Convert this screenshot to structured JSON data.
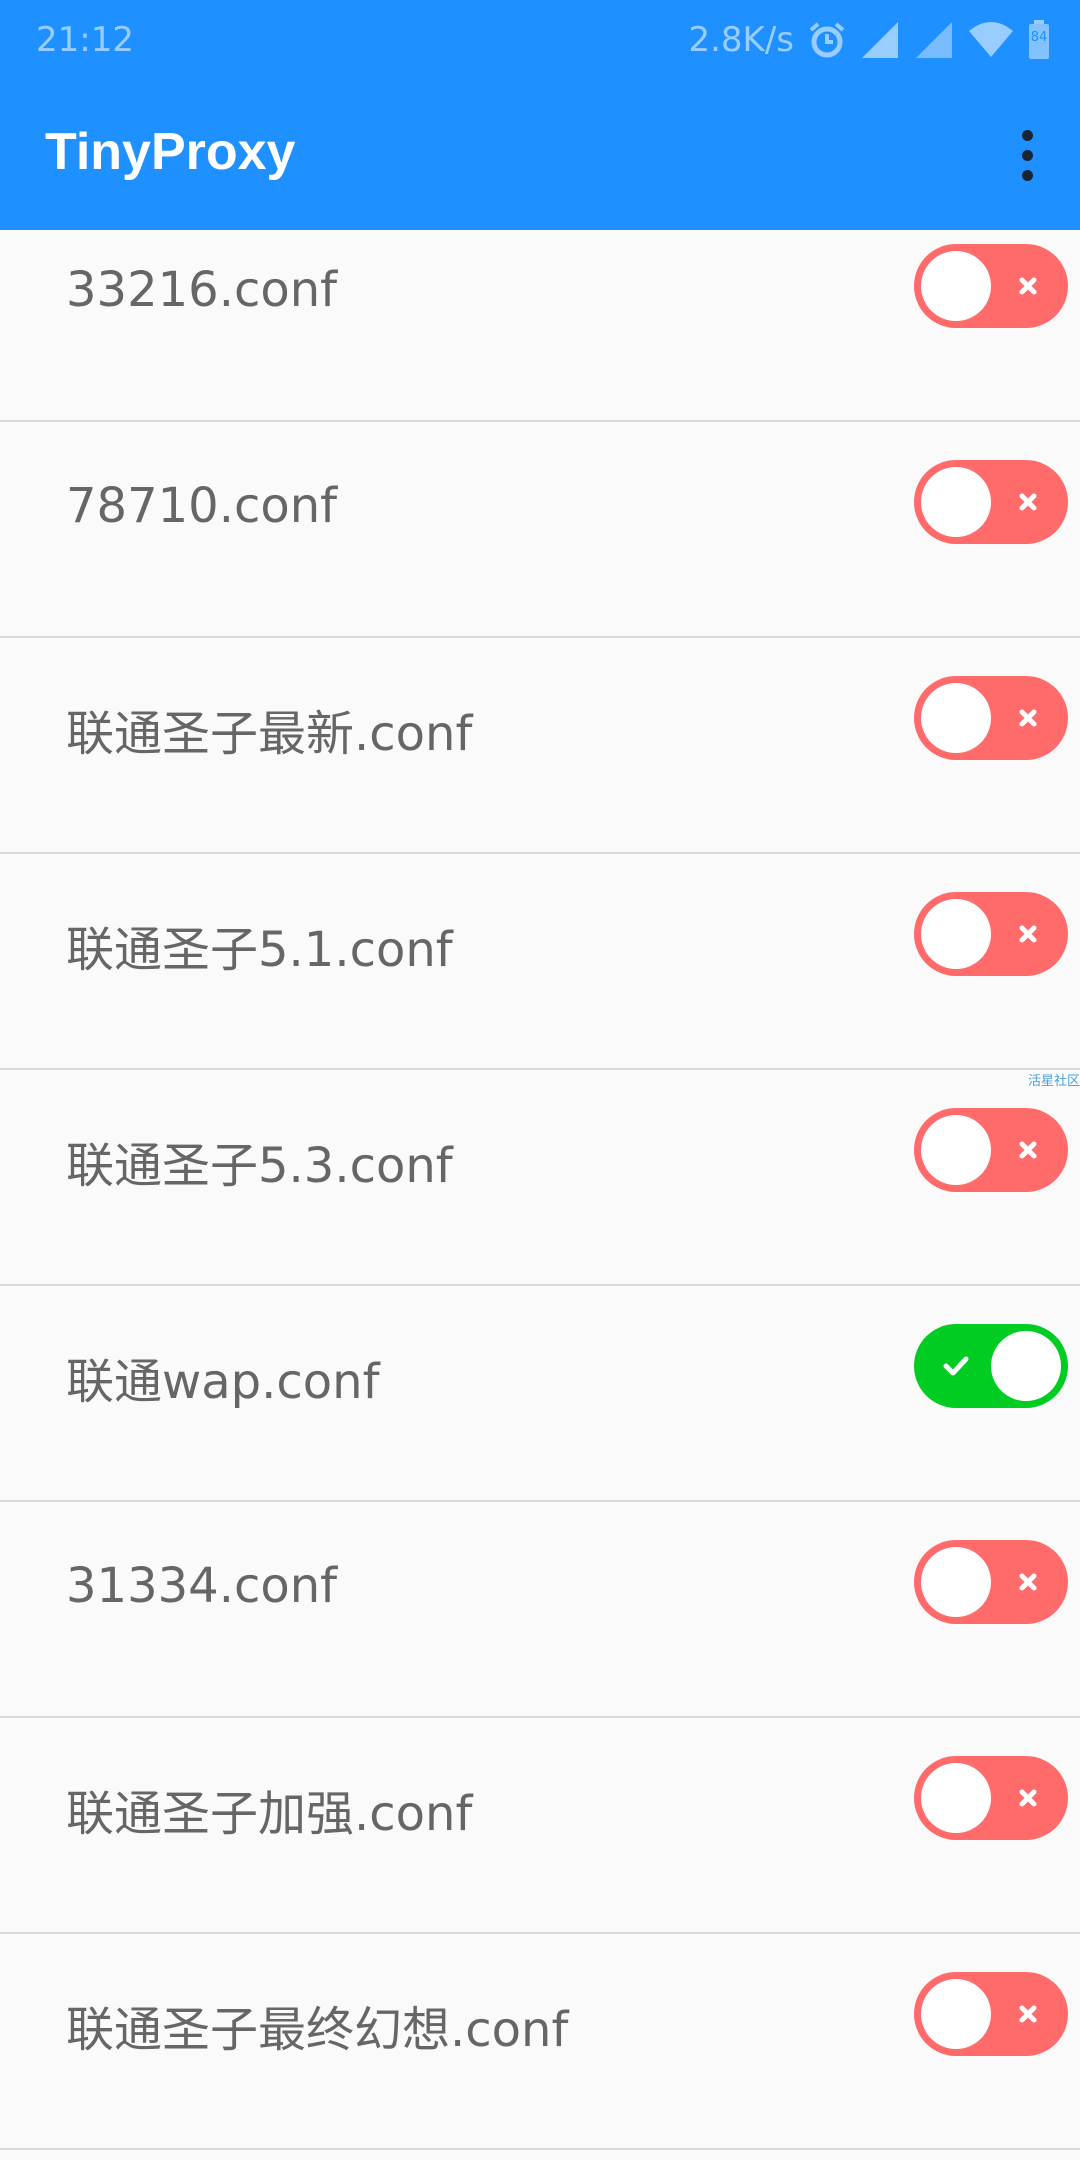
{
  "status_bar": {
    "time": "21:12",
    "network_speed": "2.8K/s",
    "battery_level": "84",
    "icons": [
      "alarm-icon",
      "signal-icon",
      "signal-icon",
      "wifi-icon",
      "battery-icon"
    ]
  },
  "app_bar": {
    "title": "TinyProxy",
    "menu_icon": "more-vert-icon"
  },
  "configs": [
    {
      "label": "33216.conf",
      "enabled": false
    },
    {
      "label": "78710.conf",
      "enabled": false
    },
    {
      "label": "联通圣子最新.conf",
      "enabled": false
    },
    {
      "label": "联通圣子5.1.conf",
      "enabled": false
    },
    {
      "label": "联通圣子5.3.conf",
      "enabled": false
    },
    {
      "label": "联通wap.conf",
      "enabled": true
    },
    {
      "label": "31334.conf",
      "enabled": false
    },
    {
      "label": "联通圣子加强.conf",
      "enabled": false
    },
    {
      "label": "联通圣子最终幻想.conf",
      "enabled": false
    }
  ],
  "watermark": "活星社区",
  "colors": {
    "primary": "#1e90ff",
    "toggle_off": "#ff6b6b",
    "toggle_on": "#00cc22"
  }
}
